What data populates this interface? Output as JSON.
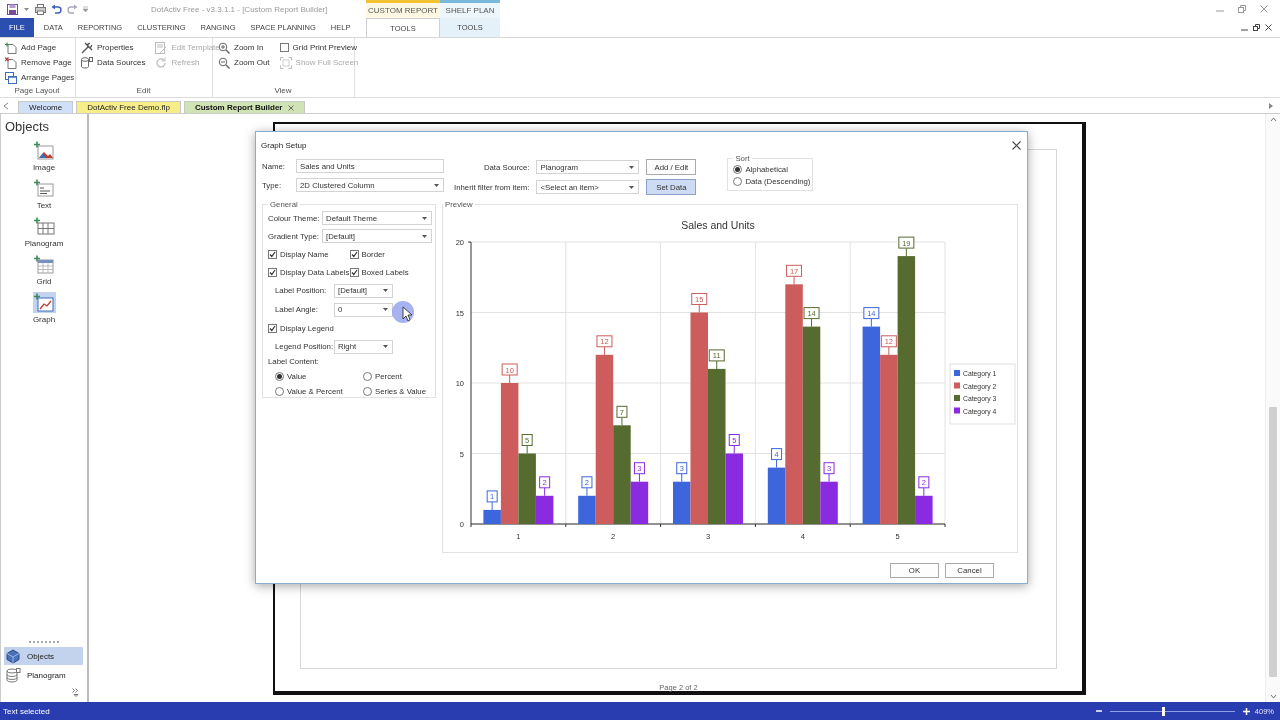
{
  "window": {
    "title": "DotActiv Free - v3.3.1.1 - [Custom Report Builder]"
  },
  "ribbon_tabs": [
    {
      "label": "FILE",
      "kind": "file",
      "selected": false
    },
    {
      "label": "DATA",
      "kind": "tab",
      "selected": false
    },
    {
      "label": "REPORTING",
      "kind": "tab",
      "selected": false
    },
    {
      "label": "CLUSTERING",
      "kind": "tab",
      "selected": false
    },
    {
      "label": "RANGING",
      "kind": "tab",
      "selected": false
    },
    {
      "label": "SPACE PLANNING",
      "kind": "tab",
      "selected": false
    },
    {
      "label": "HELP",
      "kind": "tab",
      "selected": false
    }
  ],
  "context_tabs": [
    {
      "label": "CUSTOM REPORT",
      "color": "#f2c230",
      "tab": {
        "label": "TOOLS",
        "selected": true
      }
    },
    {
      "label": "SHELF PLAN",
      "color": "#7ab8dc",
      "tab": {
        "label": "TOOLS",
        "selected": false
      }
    }
  ],
  "ribbon_groups": [
    {
      "label": "Page Layout",
      "columns": [
        [
          {
            "label": "Add Page",
            "kind": "button",
            "disabled": false
          },
          {
            "label": "Remove Page",
            "kind": "button",
            "disabled": false
          },
          {
            "label": "Arrange Pages",
            "kind": "button",
            "disabled": false
          }
        ]
      ]
    },
    {
      "label": "Edit",
      "columns": [
        [
          {
            "label": "Properties",
            "kind": "button",
            "disabled": false
          },
          {
            "label": "Data Sources",
            "kind": "button",
            "disabled": false
          }
        ],
        [
          {
            "label": "Edit Template",
            "kind": "button",
            "disabled": true
          },
          {
            "label": "Refresh",
            "kind": "button",
            "disabled": true
          }
        ]
      ]
    },
    {
      "label": "View",
      "columns": [
        [
          {
            "label": "Zoom In",
            "kind": "button",
            "disabled": false
          },
          {
            "label": "Zoom Out",
            "kind": "button",
            "disabled": false
          }
        ],
        [
          {
            "label": "Grid Print Preview",
            "kind": "checkbox",
            "checked": false,
            "disabled": false
          },
          {
            "label": "Show Full Screen",
            "kind": "button",
            "disabled": true
          }
        ]
      ]
    }
  ],
  "doc_tabs": [
    {
      "label": "Welcome",
      "color": "#cfe0f8",
      "selected": false
    },
    {
      "label": "DotActiv Free Demo.flp",
      "color": "#f7ee8a",
      "selected": false
    },
    {
      "label": "Custom Report Builder",
      "color": "#cfe3b4",
      "selected": true
    }
  ],
  "objects_panel": {
    "title": "Objects",
    "items": [
      {
        "label": "Image",
        "selected": false
      },
      {
        "label": "Text",
        "selected": false
      },
      {
        "label": "Planogram",
        "selected": false
      },
      {
        "label": "Grid",
        "selected": false
      },
      {
        "label": "Graph",
        "selected": true
      }
    ],
    "nav": [
      {
        "label": "Objects",
        "selected": true
      },
      {
        "label": "Planogram",
        "selected": false
      }
    ]
  },
  "canvas": {
    "page_label": "Page 2 of 2"
  },
  "dialog": {
    "title": "Graph Setup",
    "fields": [
      {
        "label": "Name:",
        "kind": "text",
        "value": "Sales and Units"
      },
      {
        "label": "Type:",
        "kind": "dropdown",
        "value": "2D Clustered Column"
      }
    ],
    "data_fields": [
      {
        "label": "Data Source:",
        "value": "Planogram",
        "button": {
          "label": "Add / Edit",
          "default": false
        }
      },
      {
        "label": "Inherit filter from item:",
        "value": "<Select an item>",
        "button": {
          "label": "Set Data",
          "default": true
        }
      }
    ],
    "sort": {
      "title": "Sort",
      "options": [
        {
          "label": "Alphabetical",
          "selected": true
        },
        {
          "label": "Data (Descending)",
          "selected": false
        }
      ]
    },
    "general": {
      "title": "General",
      "options": [
        {
          "kind": "select",
          "label": "Colour Theme:",
          "value": "Default Theme"
        },
        {
          "kind": "select",
          "label": "Gradient Type:",
          "value": "[Default]"
        },
        {
          "kind": "checks",
          "items": [
            {
              "label": "Display Name",
              "checked": true
            },
            {
              "label": "Border",
              "checked": true
            }
          ]
        },
        {
          "kind": "checks",
          "items": [
            {
              "label": "Display Data Labels",
              "checked": true
            },
            {
              "label": "Boxed Labels",
              "checked": true
            }
          ]
        },
        {
          "kind": "subselect",
          "label": "Label Position:",
          "value": "[Default]"
        },
        {
          "kind": "subselect",
          "label": "Label Angle:",
          "value": "0"
        },
        {
          "kind": "checks",
          "items": [
            {
              "label": "Display Legend",
              "checked": true
            }
          ]
        },
        {
          "kind": "subselect",
          "label": "Legend Position:",
          "value": "Right"
        }
      ],
      "label_content": {
        "title": "Label Content:",
        "options": [
          {
            "label": "Value",
            "selected": true
          },
          {
            "label": "Percent",
            "selected": false
          },
          {
            "label": "Value & Percent",
            "selected": false
          },
          {
            "label": "Series & Value",
            "selected": false
          }
        ]
      }
    },
    "preview": {
      "title": "Preview",
      "chart_data": {
        "type": "bar",
        "title": "Sales and Units",
        "categories": [
          "1",
          "2",
          "3",
          "4",
          "5"
        ],
        "series": [
          {
            "name": "Category 1",
            "color": "#3e66dc",
            "values": [
              1,
              2,
              3,
              4,
              14
            ]
          },
          {
            "name": "Category 2",
            "color": "#cd5c5c",
            "values": [
              10,
              12,
              15,
              17,
              12
            ]
          },
          {
            "name": "Category 3",
            "color": "#556b2f",
            "values": [
              5,
              7,
              11,
              14,
              19
            ]
          },
          {
            "name": "Category 4",
            "color": "#8a2be2",
            "values": [
              2,
              3,
              5,
              3,
              2
            ]
          }
        ],
        "ylim": [
          0,
          20
        ],
        "yticks": [
          0,
          5,
          10,
          15,
          20
        ],
        "data_labels": true,
        "grid": true,
        "legend": true
      }
    },
    "buttons": [
      "OK",
      "Cancel"
    ]
  },
  "status_bar": {
    "text": "Text selected",
    "zoom": {
      "level": 0.42,
      "reading": "409%"
    }
  }
}
